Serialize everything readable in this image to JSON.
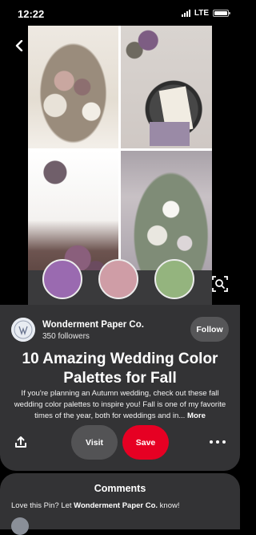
{
  "status_bar": {
    "time": "12:22",
    "network": "LTE"
  },
  "pin": {
    "image_alt": "Wedding photo collage with purple, mauve and sage swatches",
    "swatches": [
      "#9a6ab0",
      "#cf9da6",
      "#94b47e"
    ]
  },
  "creator": {
    "name": "Wonderment Paper Co.",
    "followers": "350 followers",
    "follow_label": "Follow"
  },
  "title": "10 Amazing Wedding Color Palettes for Fall",
  "description": "If you're planning an Autumn wedding, check out these fall wedding color palettes to inspire you! Fall is one of my favorite times of the year, both for weddings and in...",
  "more_label": "More",
  "actions": {
    "visit_label": "Visit",
    "save_label": "Save"
  },
  "comments": {
    "title": "Comments",
    "prompt_prefix": "Love this Pin? Let ",
    "prompt_name": "Wonderment Paper Co.",
    "prompt_suffix": " know!"
  },
  "colors": {
    "accent": "#e60023",
    "sheet": "#333335"
  }
}
